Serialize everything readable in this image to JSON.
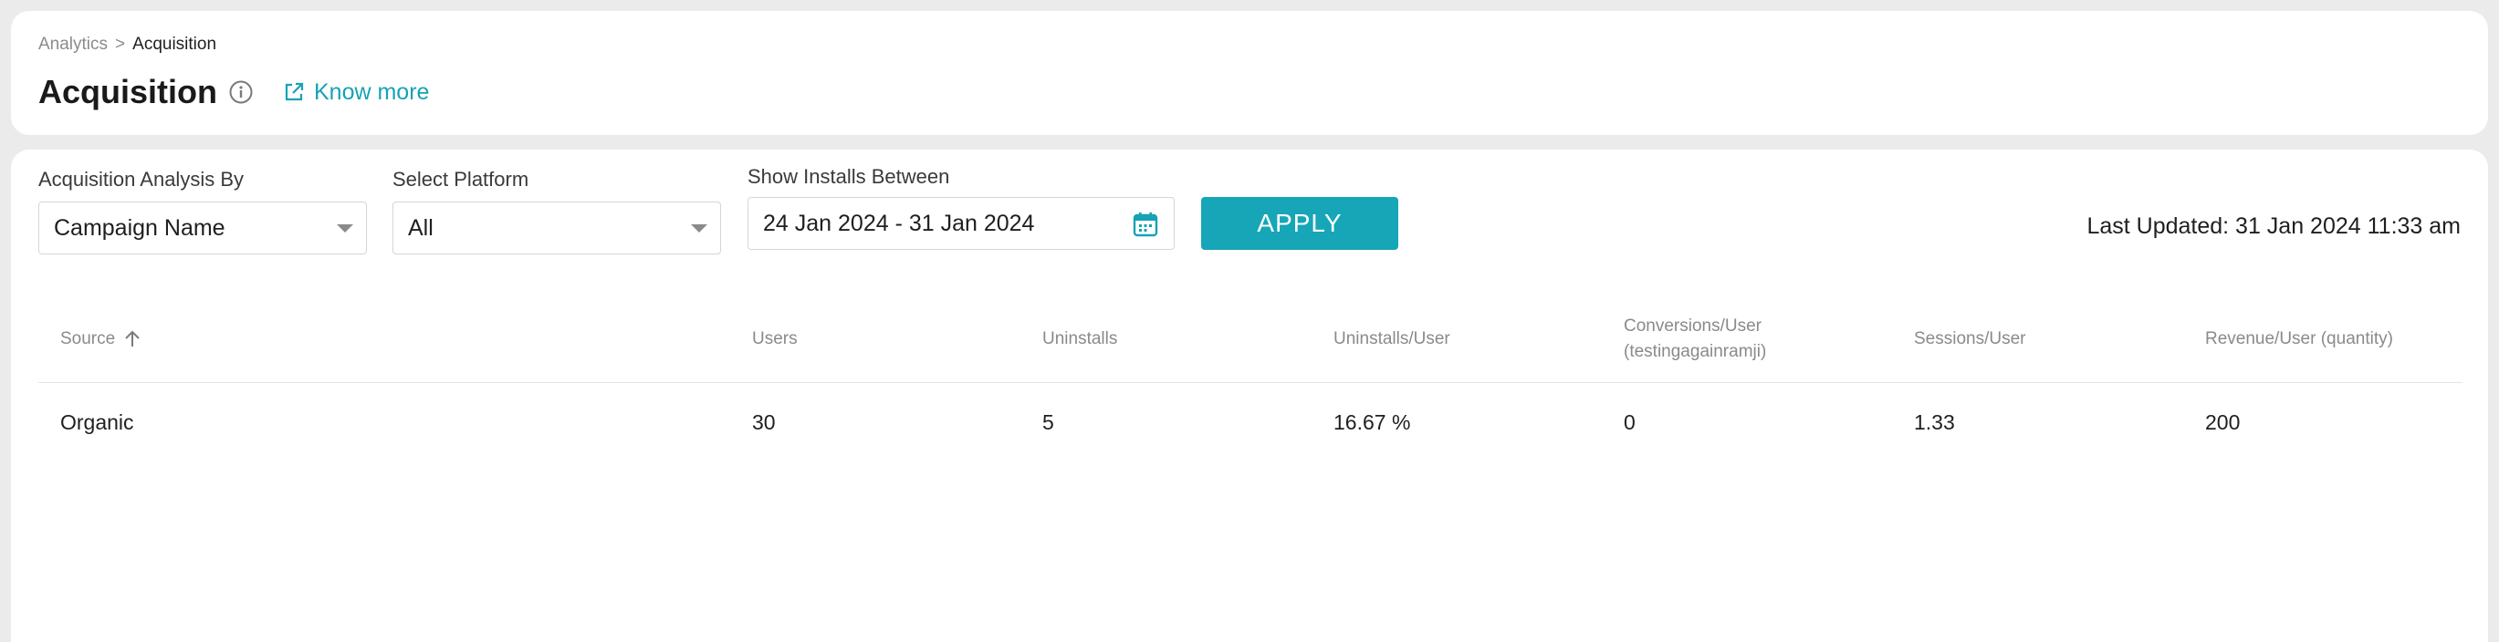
{
  "breadcrumb": {
    "parent": "Analytics",
    "separator": ">",
    "current": "Acquisition"
  },
  "page": {
    "title": "Acquisition",
    "know_more": "Know more"
  },
  "filters": {
    "analysis_by": {
      "label": "Acquisition Analysis By",
      "value": "Campaign Name"
    },
    "platform": {
      "label": "Select Platform",
      "value": "All"
    },
    "installs_between": {
      "label": "Show Installs Between",
      "value": "24 Jan 2024 - 31 Jan 2024"
    },
    "apply_label": "APPLY"
  },
  "last_updated": "Last Updated: 31 Jan 2024 11:33 am",
  "table": {
    "columns": [
      "Source",
      "Users",
      "Uninstalls",
      "Uninstalls/User",
      "Conversions/User (testingagainramji)",
      "Sessions/User",
      "Revenue/User (quantity)"
    ],
    "rows": [
      [
        "Organic",
        "30",
        "5",
        "16.67 %",
        "0",
        "1.33",
        "200"
      ]
    ]
  },
  "colors": {
    "accent": "#16a6b7",
    "link": "#15a3b5",
    "background": "#ebebeb"
  }
}
